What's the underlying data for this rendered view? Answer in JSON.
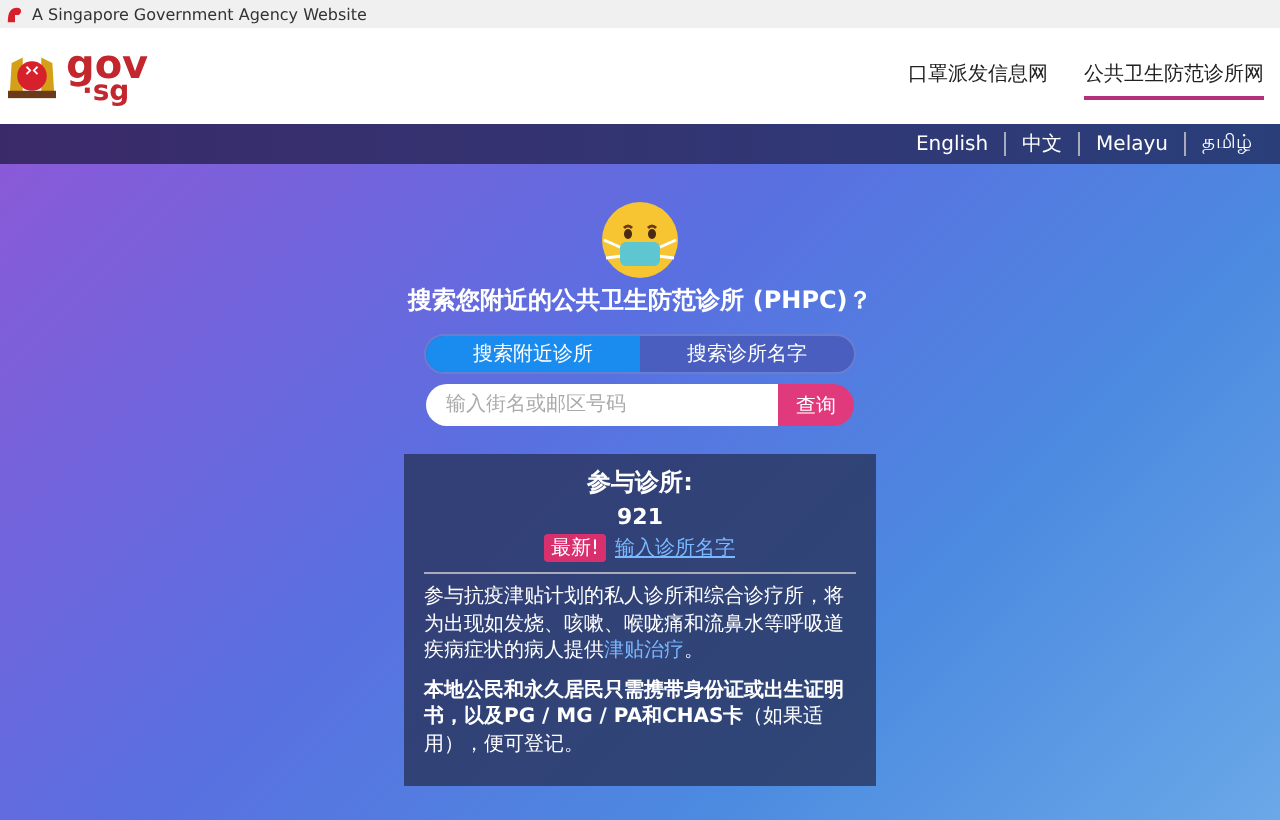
{
  "agency_bar": {
    "text": "A Singapore Government Agency Website"
  },
  "header": {
    "logo_text_1": "gov",
    "logo_text_2": "·sg",
    "nav": [
      {
        "label": "口罩派发信息网",
        "selected": false
      },
      {
        "label": "公共卫生防范诊所网",
        "selected": true
      }
    ]
  },
  "languages": [
    "English",
    "中文",
    "Melayu",
    "தமிழ்"
  ],
  "hero": {
    "title": "搜索您附近的公共卫生防范诊所 (PHPC)？",
    "tabs": [
      {
        "label": "搜索附近诊所",
        "selected": true
      },
      {
        "label": "搜索诊所名字",
        "selected": false
      }
    ],
    "search": {
      "placeholder": "输入街名或邮区号码",
      "button": "查询"
    }
  },
  "card": {
    "heading": "参与诊所:",
    "count": "921",
    "badge": "最新!",
    "link": "输入诊所名字",
    "paragraph_1": "参与抗疫津贴计划的私人诊所和综合诊疗所，将为出现如发烧、咳嗽、喉咙痛和流鼻水等呼吸道疾病症状的病人提供",
    "paragraph_1_link": "津贴治疗",
    "paragraph_1_end": "。",
    "paragraph_2": "**本地公民和永久居民只需携带身份证或出生证明书，以及PG / MG / PA和CHAS卡**（如果适用），便可登记。"
  }
}
